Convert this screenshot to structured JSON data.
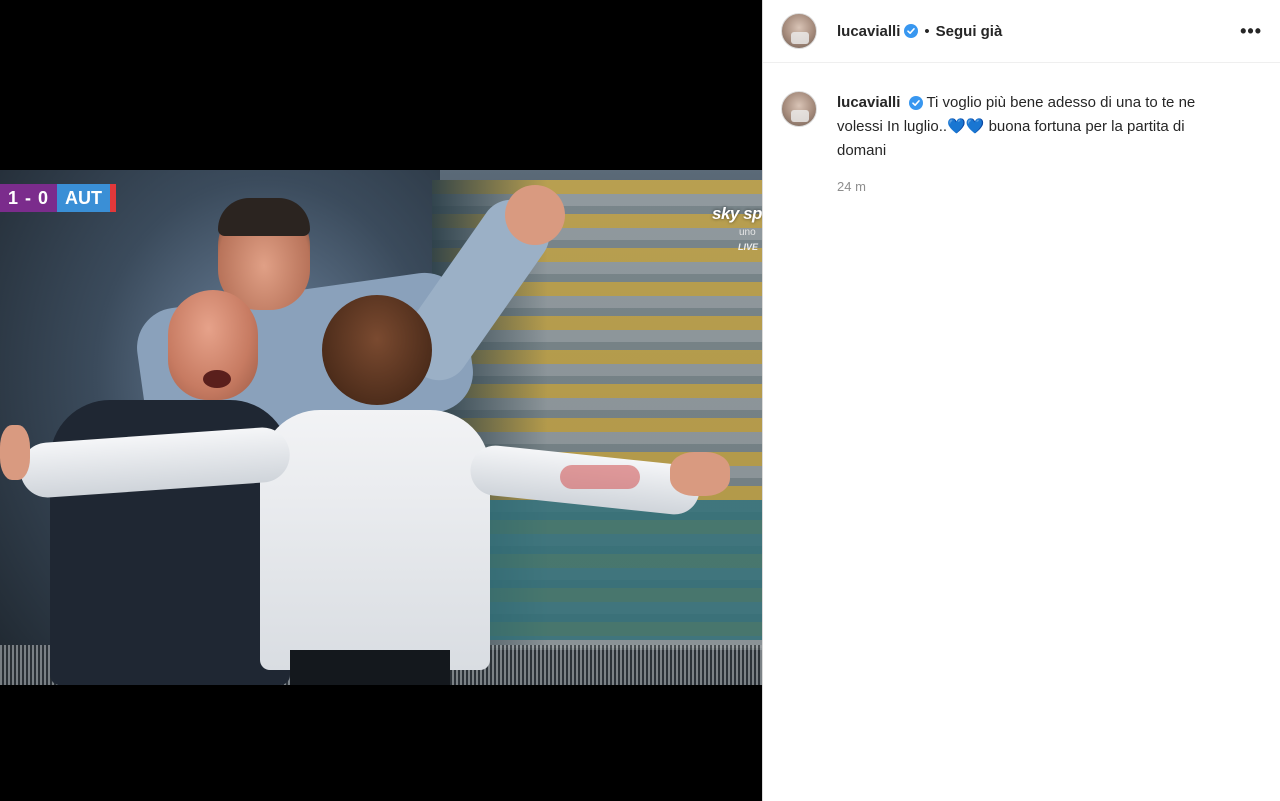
{
  "media": {
    "scoreboard": {
      "score": "1 - 0",
      "team": "AUT"
    },
    "broadcaster": {
      "logo": "sky sp",
      "sub": "uno",
      "live": "LIVE"
    }
  },
  "post": {
    "header": {
      "username": "lucavialli",
      "separator": "•",
      "follow_label": "Segui già",
      "more_label": "•••"
    },
    "caption": {
      "username": "lucavialli",
      "text": "Ti voglio più bene adesso di una to te ne volessi In luglio..💙💙 buona fortuna per la partita di domani"
    },
    "timestamp": "24 m"
  },
  "colors": {
    "verified": "#3897f0",
    "text": "#262626",
    "muted": "#8e8e8e",
    "score_bg": "#7b2c8c",
    "team_bg": "#3a8fd6"
  }
}
